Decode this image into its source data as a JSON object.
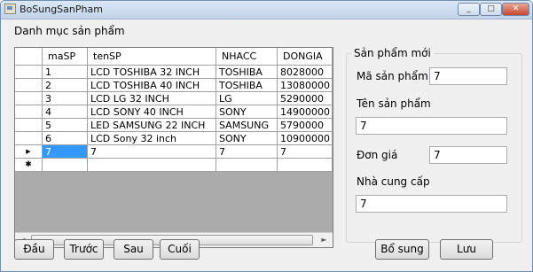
{
  "window": {
    "title": "BoSungSanPham",
    "min_glyph": "_",
    "max_glyph": "□",
    "close_glyph": "✕"
  },
  "heading": "Danh mục sản phẩm",
  "grid": {
    "columns": [
      "maSP",
      "tenSP",
      "NHACC",
      "DONGIA"
    ],
    "rows": [
      [
        "1",
        "LCD TOSHIBA 32 INCH",
        "TOSHIBA",
        "8028000"
      ],
      [
        "2",
        "LCD TOSHIBA 40 INCH",
        "TOSHIBA",
        "13080000"
      ],
      [
        "3",
        "LCD LG 32 INCH",
        "LG",
        "5290000"
      ],
      [
        "4",
        "LCD SONY 40 INCH",
        "SONY",
        "14900000"
      ],
      [
        "5",
        "LED SAMSUNG 22 INCH",
        "SAMSUNG",
        "5790000"
      ],
      [
        "6",
        "LCD Sony 32 inch",
        "SONY",
        "10900000"
      ],
      [
        "7",
        "7",
        "7",
        "7"
      ],
      [
        "",
        "",
        "",
        ""
      ]
    ],
    "current_row_marker": "▶",
    "new_row_marker": "✱",
    "scroll_left": "◄",
    "scroll_right": "►"
  },
  "form": {
    "group_title": "Sản phẩm mới",
    "ma_label": "Mã sản phẩm",
    "ma_value": "7",
    "ten_label": "Tên sản phẩm",
    "ten_value": "7",
    "gia_label": "Đơn giá",
    "gia_value": "7",
    "ncc_label": "Nhà cung cấp",
    "ncc_value": "7"
  },
  "buttons": {
    "first": "Đầu",
    "prev": "Trước",
    "next": "Sau",
    "last": "Cuối",
    "add": "Bổ sung",
    "save": "Lưu"
  }
}
